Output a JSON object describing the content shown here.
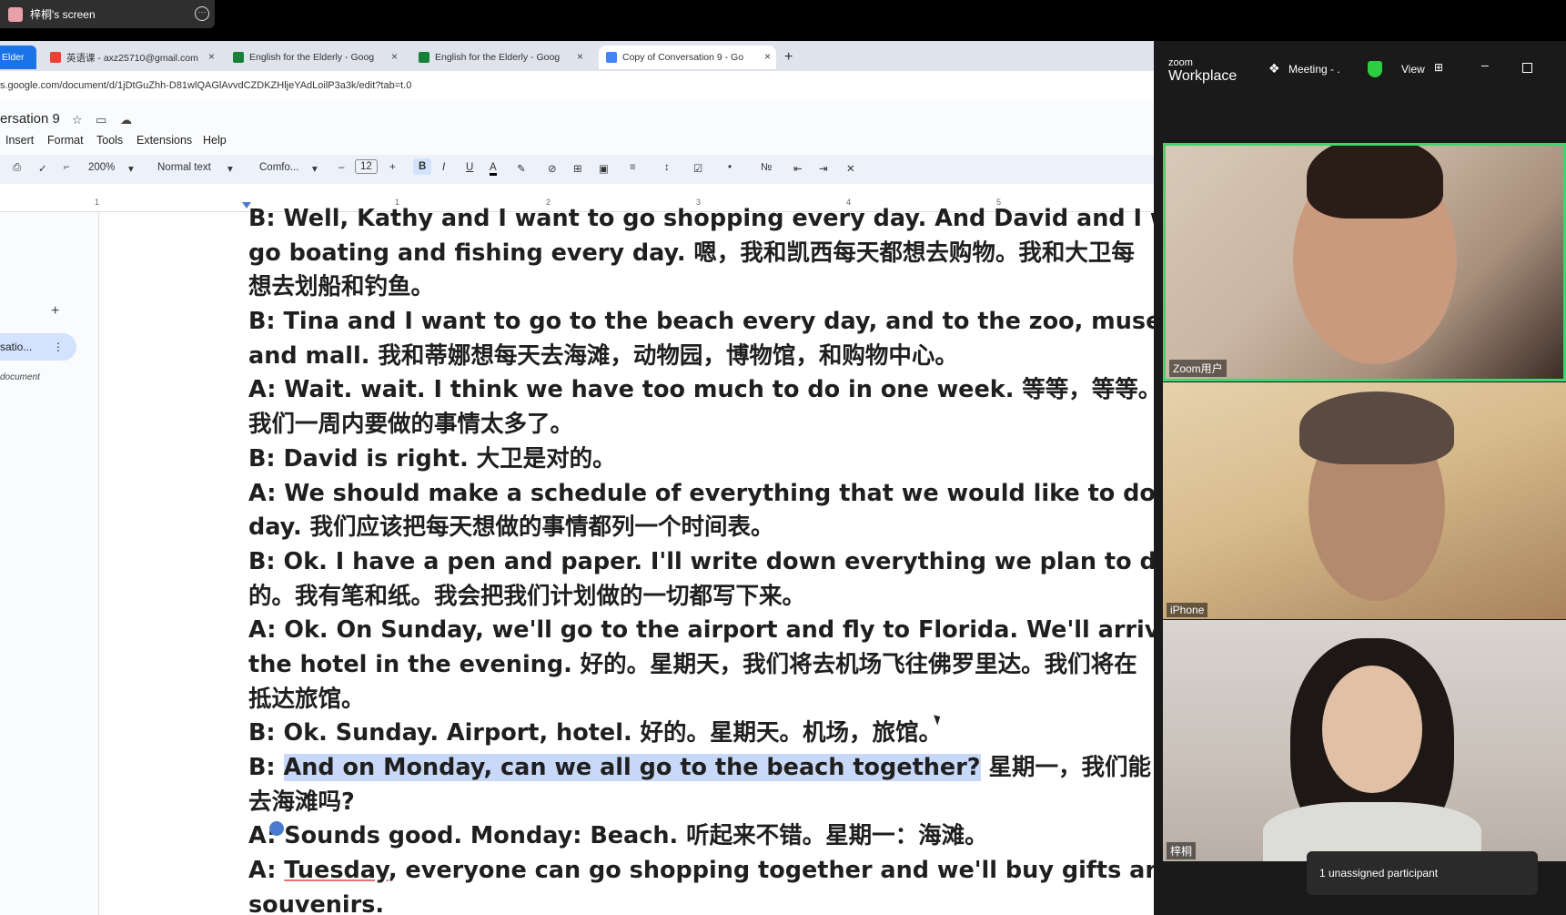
{
  "share": {
    "title": "梓桐's screen"
  },
  "tabs": [
    {
      "label": "Elder",
      "color": "#1a73e8"
    },
    {
      "label": "英语课 - axz25710@gmail.com",
      "color": "#ea4335"
    },
    {
      "label": "English for the Elderly - Goog",
      "color": "#188038"
    },
    {
      "label": "English for the Elderly - Goog",
      "color": "#188038"
    },
    {
      "label": "Copy of Conversation 9 - Go",
      "color": "#4285f4"
    }
  ],
  "tab_close": "×",
  "new_tab": "+",
  "url": "s.google.com/document/d/1jDtGuZhh-D81wlQAGlAvvdCZDKZHljeYAdLoilP3a3k/edit?tab=t.0",
  "doc": {
    "title": "ersation 9",
    "menus": [
      "Insert",
      "Format",
      "Tools",
      "Extensions",
      "Help"
    ]
  },
  "toolbar": {
    "zoom": "200%",
    "style": "Normal text",
    "font": "Comfo...",
    "size": "12",
    "bold": "B",
    "italic": "I",
    "underline": "U",
    "text_color": "A",
    "minus": "–",
    "plus": "+"
  },
  "ruler": [
    "1",
    "1",
    "2",
    "3",
    "4",
    "5"
  ],
  "sidebar": {
    "plus": "+",
    "tab_label": "satio...",
    "sub": "document"
  },
  "lines": [
    "B: Well, Kathy and I want to go shopping every day. And David and I wa",
    "go boating and fishing every day. 嗯，我和凯西每天都想去购物。我和大卫每",
    "想去划船和钓鱼。",
    "B: Tina and I want to go to the beach every day, and to the zoo, museu",
    "and mall. 我和蒂娜想每天去海滩，动物园，博物馆，和购物中心。",
    "A: Wait. wait. I think we have too much to do in one week. 等等，等等。我",
    "我们一周内要做的事情太多了。",
    "B: David is right. 大卫是对的。",
    "A: We should make a schedule of everything that we would like to do e",
    "day. 我们应该把每天想做的事情都列一个时间表。",
    "B: Ok. I have a pen and paper. I'll write down everything we plan to do.",
    "的。我有笔和纸。我会把我们计划做的一切都写下来。",
    "A: Ok. On Sunday, we'll go to the airport and fly to Florida. We'll arrive",
    "the hotel in the evening. 好的。星期天，我们将去机场飞往佛罗里达。我们将在",
    "抵达旅馆。",
    "B: Ok. Sunday. Airport, hotel. 好的。星期天。机场，旅馆。"
  ],
  "hl_line": {
    "prefix": "B: ",
    "highlight": "And on Monday, can we all go to the beach together?",
    "rest": " 星期一，我们能"
  },
  "lines2": [
    "去海滩吗?",
    "A: Sounds good. Monday: Beach. 听起来不错。星期一：海滩。"
  ],
  "last_line": {
    "prefix": "A: ",
    "underlined": "Tuesday",
    "rest": ", everyone can go shopping together and we'll buy gifts and"
  },
  "final_line": "souvenirs.",
  "zoom": {
    "logo_small": "zoom",
    "logo_big": "Workplace",
    "meeting": "Meeting - .",
    "view": "View",
    "participants": [
      {
        "name": "Zoom用户"
      },
      {
        "name": "iPhone"
      },
      {
        "name": "梓桐"
      }
    ],
    "notice": "1 unassigned participant",
    "minimize": "–"
  }
}
